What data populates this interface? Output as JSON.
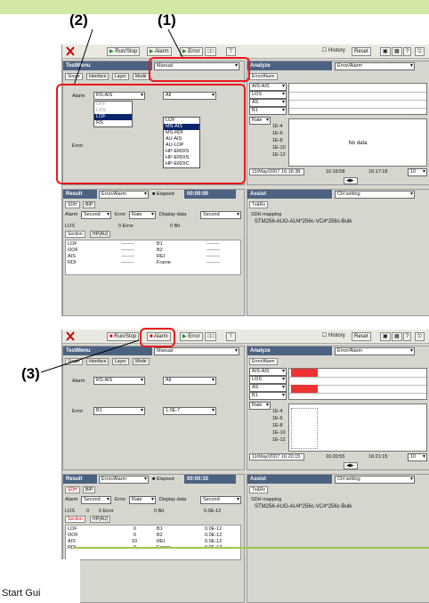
{
  "callouts": {
    "c1": "(1)",
    "c2": "(2)",
    "c3": "(3)"
  },
  "footer": {
    "text": "Start Gui"
  },
  "colors": {
    "accent_green": "#d3e8a5",
    "highlight_red": "#e8191c",
    "title_blue": "#4c6282"
  },
  "shot1": {
    "toolbar": {
      "runstop": "Run/Stop",
      "alarm": "Alarm",
      "error": "Error",
      "history": "History",
      "reset": "Reset"
    },
    "test_menu": {
      "title": "TestMenu",
      "mode": "Manual",
      "tabs": [
        "Single",
        "Interface",
        "Layer",
        "Mode"
      ],
      "alarm_label": "Alarm",
      "alarm_value": "RS-AIS",
      "all_value": "All",
      "error_label": "Error",
      "left_list": [
        "OFF",
        "LOS",
        "LOF",
        "RS"
      ],
      "right_list": [
        "LOF",
        "MS-AIS",
        "MS-RDI",
        "AU-AIS",
        "AU-LOP",
        "HP-ERDIS",
        "HP-ERDIS",
        "HP-ERDIC"
      ]
    },
    "analyze": {
      "title": "Analyze",
      "mode": "Error/Alarm",
      "tab": "Error/Alarm",
      "rows": [
        "AIS-AIS",
        "LOS",
        "AS",
        "B1"
      ],
      "rate_label": "Rate",
      "rate_values": [
        "1E-4",
        "1E-6",
        "1E-8",
        "1E-10",
        "1E-12"
      ],
      "no_data": "No data",
      "times": [
        "11/May/2007 16:16:38",
        "16:16:58",
        "16:17:18",
        "10"
      ]
    },
    "result": {
      "title": "Result",
      "mode": "Error/Alarm",
      "elapsed_label": "Elapsed",
      "elapsed": "00:00:00",
      "tabs": [
        "SDH",
        "BIP"
      ],
      "alarm_label": "Alarm",
      "alarm_mode": "Second",
      "error_label": "Error",
      "error_mode": "Rate",
      "display_label": "Display data",
      "display_mode": "Second",
      "los_label": "LOS",
      "col_err": "0 Error",
      "col_bit": "0 Bit",
      "subtabs": [
        "Section",
        "HP(AU)"
      ],
      "left_names": [
        "LOF",
        "OOF",
        "AIS",
        "RDI"
      ],
      "left_vals": [
        "--------",
        "--------",
        "--------",
        "--------"
      ],
      "right_names": [
        "B1",
        "B2",
        "REI",
        "Frame"
      ],
      "right_vals": [
        "--------",
        "--------",
        "--------",
        "--------"
      ]
    },
    "assist": {
      "title": "Assist",
      "mode": "CH setting",
      "tab": "Tx&Rx",
      "mapping_label": "SDH mapping",
      "mapping": "STM256-AUG-AU4*256c-VC4*256c-Bulk"
    }
  },
  "shot2": {
    "toolbar": {
      "runstop": "Run/Stop",
      "alarm": "Alarm",
      "error": "Error",
      "history": "History",
      "reset": "Reset"
    },
    "test_menu": {
      "title": "TestMenu",
      "mode": "Manual",
      "tabs": [
        "Single",
        "Interface",
        "Layer",
        "Mode"
      ],
      "alarm_label": "Alarm",
      "alarm_value": "RS-AIS",
      "all_value": "All",
      "error_label": "Error",
      "error_value": "B1",
      "error_rate": "1.0E-7"
    },
    "analyze": {
      "title": "Analyze",
      "mode": "Error/Alarm",
      "tab": "Error/Alarm",
      "rows": [
        "AIS-AIS",
        "LOS",
        "AS",
        "B1"
      ],
      "rate_label": "Rate",
      "rate_values": [
        "1E-4",
        "1E-6",
        "1E-8",
        "1E-10",
        "1E-12"
      ],
      "times": [
        "11/May/2007 16:20:15",
        "16:20:55",
        "16:21:15",
        "10"
      ]
    },
    "result": {
      "title": "Result",
      "mode": "Error/Alarm",
      "elapsed_label": "Elapsed",
      "elapsed": "00:00:10",
      "tabs": [
        "SDH",
        "BIP"
      ],
      "alarm_label": "Alarm",
      "alarm_mode": "Second",
      "error_label": "Error",
      "error_mode": "Rate",
      "display_label": "Display data",
      "display_mode": "Second",
      "los_label": "LOS",
      "los_val": "0",
      "col_err": "0 Error",
      "col_bit": "0 Bit",
      "los_rate": "0.0E-12",
      "subtabs": [
        "Section",
        "HP(AU)"
      ],
      "left_names": [
        "LOF",
        "OOF",
        "AIS",
        "RDI"
      ],
      "left_vals": [
        "0",
        "0",
        "10",
        "0"
      ],
      "right_names": [
        "B1",
        "B2",
        "REI",
        "Frame"
      ],
      "right_vals": [
        "0.0E-12",
        "0.0E-12",
        "0.0E-12",
        "0.0E-12"
      ]
    },
    "assist": {
      "title": "Assist",
      "mode": "CH setting",
      "tab": "Tx&Rx",
      "mapping_label": "SDH mapping",
      "mapping": "STM256-AUG-AU4*256c-VC4*256c-Bulk"
    }
  }
}
